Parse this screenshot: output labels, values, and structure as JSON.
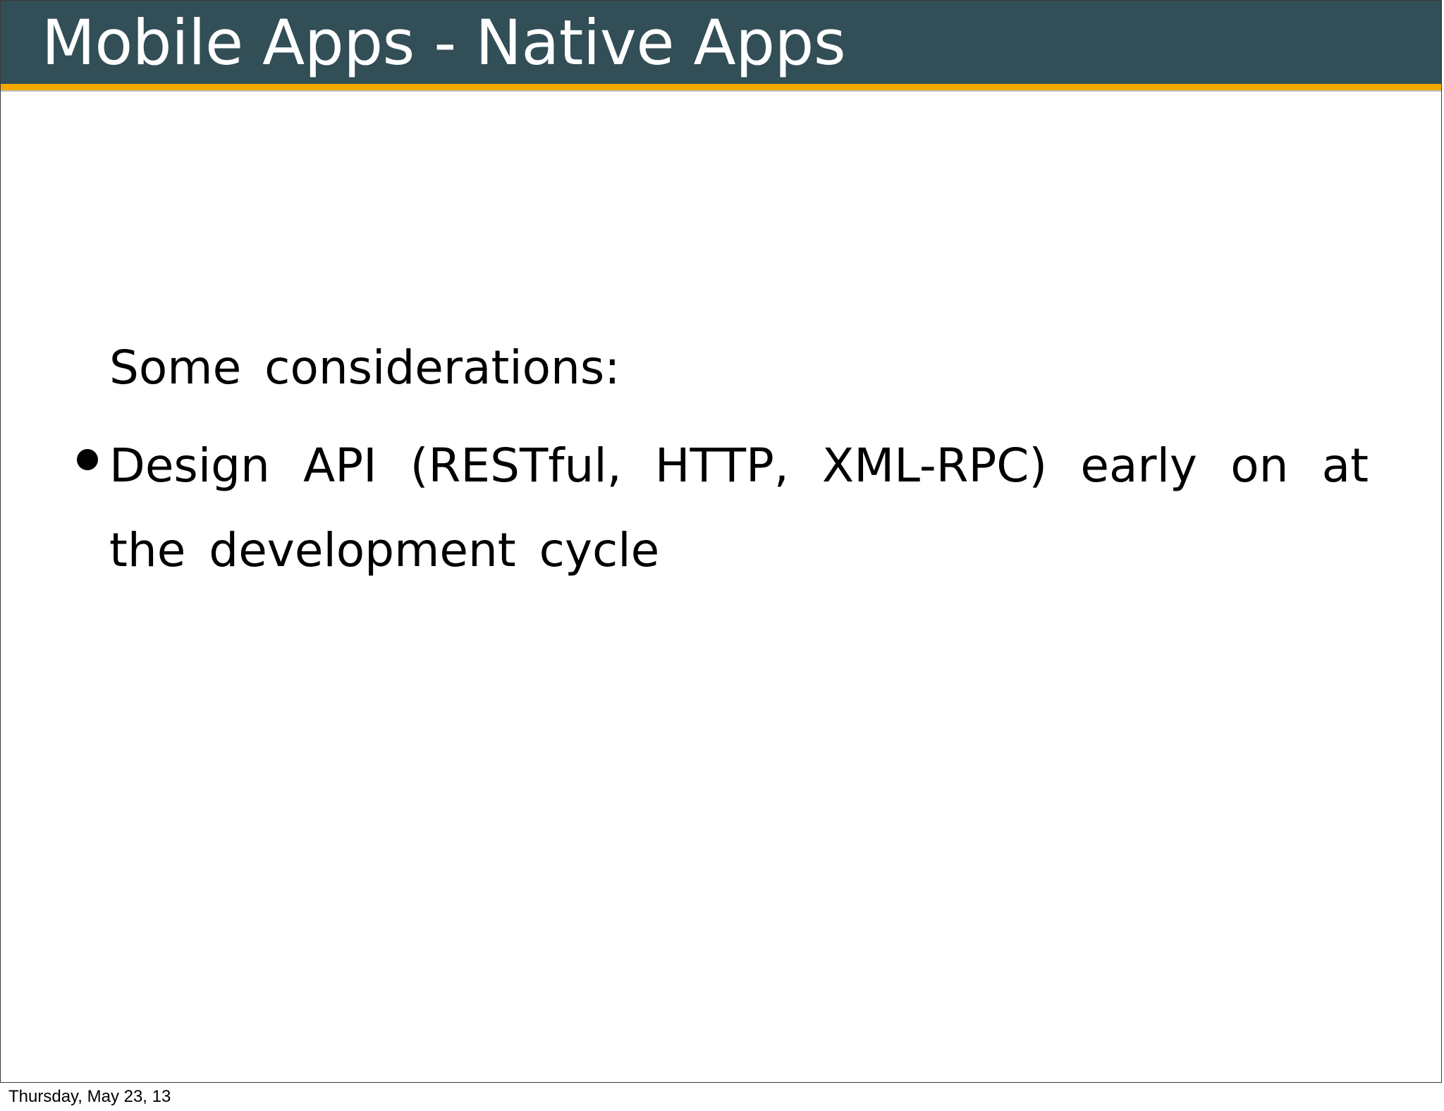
{
  "slide": {
    "title": "Mobile Apps - Native Apps",
    "intro": "Some considerations:",
    "bullets": [
      {
        "text": "Design API (RESTful, HTTP, XML-RPC) early on at the development cycle"
      }
    ]
  },
  "footer": {
    "date": "Thursday, May 23, 13"
  },
  "colors": {
    "title_bar": "#324e56",
    "accent": "#f2a900",
    "title_text": "#ffffff",
    "body_text": "#000000"
  },
  "icons": {
    "bullet": "bullet-dot-icon"
  }
}
